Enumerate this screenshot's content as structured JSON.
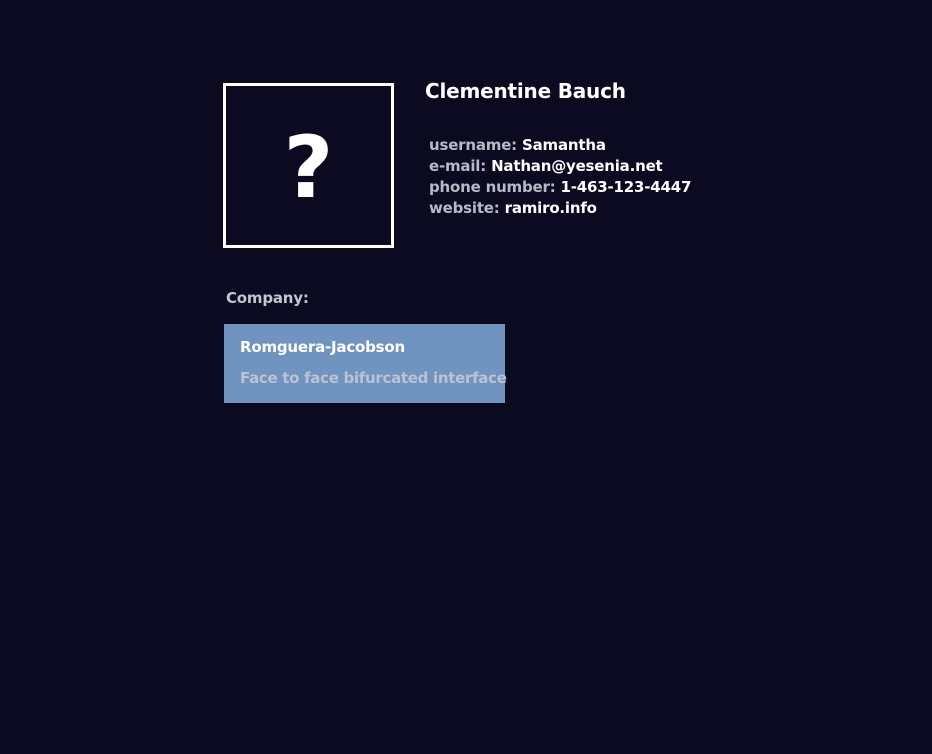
{
  "profile": {
    "avatar_glyph": "?",
    "name": "Clementine Bauch",
    "details": [
      {
        "label": "username:",
        "value": "Samantha"
      },
      {
        "label": "e-mail:",
        "value": "Nathan@yesenia.net"
      },
      {
        "label": "phone number:",
        "value": "1-463-123-4447"
      },
      {
        "label": "website:",
        "value": "ramiro.info"
      }
    ]
  },
  "company": {
    "heading": "Company:",
    "name": "Romguera-Jacobson",
    "catch_phrase": "Face to face bifurcated interface"
  },
  "colors": {
    "background": "#0b0a20",
    "card": "#7093bf",
    "text_primary": "#ffffff",
    "text_label": "#b7b9c6"
  },
  "icons": {
    "avatar_placeholder": "question-mark-icon"
  }
}
